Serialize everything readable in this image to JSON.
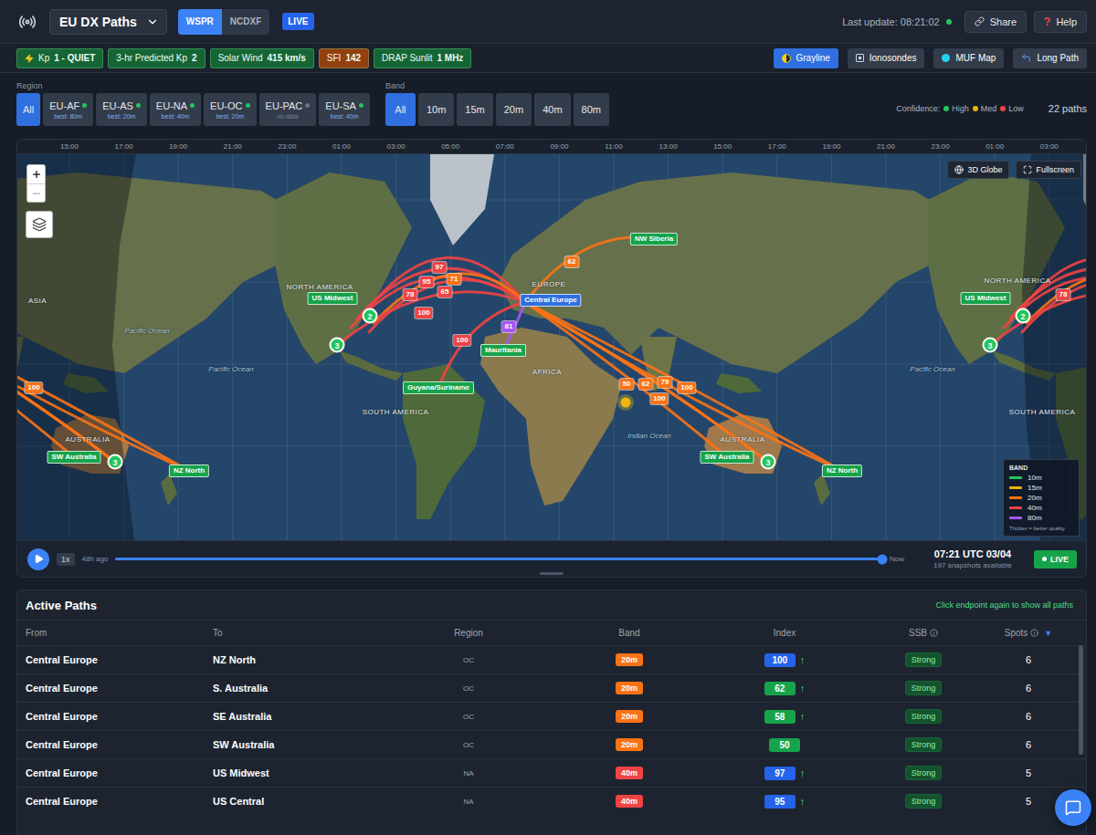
{
  "header": {
    "title": "EU DX Paths",
    "modes": [
      {
        "label": "WSPR",
        "selected": true
      },
      {
        "label": "NCDXF",
        "selected": false
      }
    ],
    "live": "LIVE",
    "last_update": "Last update: 08:21:02",
    "share": "Share",
    "help": {
      "icon": "?",
      "label": "Help"
    }
  },
  "status_chips": [
    {
      "label": "Kp",
      "value": "1 - QUIET",
      "kind": "alert",
      "color": "#166534"
    },
    {
      "label": "3-hr Predicted Kp",
      "value": "2",
      "kind": "metric",
      "color": "#166534"
    },
    {
      "label": "Solar Wind",
      "value": "415 km/s",
      "kind": "metric",
      "color": "#166534"
    },
    {
      "label": "SFI",
      "value": "142",
      "kind": "metric",
      "color": "#92400e"
    },
    {
      "label": "DRAP Sunlit",
      "value": "1 MHz",
      "kind": "metric",
      "color": "#166534"
    }
  ],
  "overlays": [
    {
      "label": "Grayline",
      "kind": "grayline",
      "selected": true
    },
    {
      "label": "Ionosondes",
      "kind": "ionosondes",
      "selected": false
    },
    {
      "label": "MUF Map",
      "kind": "muf",
      "selected": false
    },
    {
      "label": "Long Path",
      "kind": "longpath",
      "selected": false
    }
  ],
  "region": {
    "label": "Region",
    "options": [
      {
        "label": "All",
        "selected": true,
        "sub": null,
        "dot": null,
        "available": true
      },
      {
        "label": "EU-AF",
        "selected": false,
        "sub": "best: 80m",
        "dot": "#22c55e",
        "available": true
      },
      {
        "label": "EU-AS",
        "selected": false,
        "sub": "best: 20m",
        "dot": "#22c55e",
        "available": true
      },
      {
        "label": "EU-NA",
        "selected": false,
        "sub": "best: 40m",
        "dot": "#22c55e",
        "available": true
      },
      {
        "label": "EU-OC",
        "selected": false,
        "sub": "best: 20m",
        "dot": "#22c55e",
        "available": true
      },
      {
        "label": "EU-PAC",
        "selected": false,
        "sub": "no data",
        "dot": "#6b7280",
        "available": false
      },
      {
        "label": "EU-SA",
        "selected": false,
        "sub": "best: 40m",
        "dot": "#22c55e",
        "available": true
      }
    ]
  },
  "band_filter": {
    "label": "Band",
    "options": [
      {
        "label": "All",
        "selected": true
      },
      {
        "label": "10m",
        "selected": false
      },
      {
        "label": "15m",
        "selected": false
      },
      {
        "label": "20m",
        "selected": false
      },
      {
        "label": "40m",
        "selected": false
      },
      {
        "label": "80m",
        "selected": false
      }
    ]
  },
  "confidence": {
    "label": "Confidence:",
    "levels": [
      {
        "label": "High",
        "color": "#22c55e"
      },
      {
        "label": "Med",
        "color": "#eab308"
      },
      {
        "label": "Low",
        "color": "#ef4444"
      }
    ]
  },
  "path_count": "22 paths",
  "map": {
    "time_ticks": [
      "15:00",
      "17:00",
      "19:00",
      "21:00",
      "23:00",
      "01:00",
      "03:00",
      "05:00",
      "07:00",
      "09:00",
      "11:00",
      "13:00",
      "15:00",
      "17:00",
      "19:00",
      "21:00",
      "23:00",
      "01:00",
      "03:00"
    ],
    "labels": [
      {
        "text": "NORTH AMERICA",
        "kind": "continent"
      },
      {
        "text": "NORTH AMERICA",
        "kind": "continent"
      },
      {
        "text": "SOUTH AMERICA",
        "kind": "continent"
      },
      {
        "text": "SOUTH AMERICA",
        "kind": "continent"
      },
      {
        "text": "EUROPE",
        "kind": "continent"
      },
      {
        "text": "AFRICA",
        "kind": "continent"
      },
      {
        "text": "AUSTRALIA",
        "kind": "continent"
      },
      {
        "text": "AUSTRALIA",
        "kind": "continent"
      },
      {
        "text": "ASIA",
        "kind": "continent"
      },
      {
        "text": "Pacific Ocean",
        "kind": "ocean"
      },
      {
        "text": "Pacific Ocean",
        "kind": "ocean"
      },
      {
        "text": "Pacific Ocean",
        "kind": "ocean"
      },
      {
        "text": "Indian Ocean",
        "kind": "ocean"
      }
    ],
    "endpoints": [
      {
        "name": "Central Europe",
        "kind": "origin"
      },
      {
        "name": "US Midwest",
        "kind": "dest"
      },
      {
        "name": "NW Siberia",
        "kind": "dest"
      },
      {
        "name": "Mauritania",
        "kind": "dest"
      },
      {
        "name": "Guyana/Suriname",
        "kind": "dest"
      },
      {
        "name": "SW Australia",
        "kind": "dest"
      },
      {
        "name": "NZ North",
        "kind": "dest"
      }
    ],
    "clusters": [
      {
        "count": "2"
      },
      {
        "count": "3"
      },
      {
        "count": "3"
      }
    ],
    "paths": [
      {
        "band": "40m",
        "index": "97"
      },
      {
        "band": "40m",
        "index": "95"
      },
      {
        "band": "40m",
        "index": "78"
      },
      {
        "band": "40m",
        "index": "65"
      },
      {
        "band": "20m",
        "index": "71"
      },
      {
        "band": "40m",
        "index": "100"
      },
      {
        "band": "40m",
        "index": "100"
      },
      {
        "band": "80m",
        "index": "81"
      },
      {
        "band": "20m",
        "index": "62"
      },
      {
        "band": "20m",
        "index": "50"
      },
      {
        "band": "20m",
        "index": "62"
      },
      {
        "band": "20m",
        "index": "79"
      },
      {
        "band": "20m",
        "index": "100"
      },
      {
        "band": "20m",
        "index": "100"
      }
    ],
    "buttons": [
      {
        "label": "3D Globe",
        "kind": "globe"
      },
      {
        "label": "Fullscreen",
        "kind": "fullscreen"
      }
    ],
    "zoom": {
      "in_disabled": false,
      "out_disabled": true
    },
    "legend": {
      "title": "BAND",
      "items": [
        {
          "label": "10m",
          "color": "#22c55e"
        },
        {
          "label": "15m",
          "color": "#eab308"
        },
        {
          "label": "20m",
          "color": "#f97316"
        },
        {
          "label": "40m",
          "color": "#ef4444"
        },
        {
          "label": "80m",
          "color": "#a855f7"
        }
      ],
      "note": "Thicker = better quality"
    }
  },
  "timeline": {
    "playing": false,
    "speed": "1x",
    "start": "48h ago",
    "end": "Now",
    "level": 1,
    "time": "07:21 UTC 03/04",
    "snapshots": "197 snapshots available",
    "live": "LIVE"
  },
  "table": {
    "title": "Active Paths",
    "hint": "Click endpoint again to show all paths",
    "columns": [
      {
        "label": "From",
        "info": false,
        "sort": null
      },
      {
        "label": "To",
        "info": false,
        "sort": null
      },
      {
        "label": "Region",
        "info": false,
        "sort": null
      },
      {
        "label": "Band",
        "info": false,
        "sort": null
      },
      {
        "label": "Index",
        "info": false,
        "sort": null
      },
      {
        "label": "SSB",
        "info": true,
        "sort": null
      },
      {
        "label": "Spots",
        "info": true,
        "sort": "▼"
      }
    ],
    "rows": [
      {
        "from": "Central Europe",
        "to": "NZ North",
        "region": "OC",
        "band": "20m",
        "index": "100",
        "index_color": "#2563eb",
        "trend": "↑",
        "ssb": "Strong",
        "spots": "6"
      },
      {
        "from": "Central Europe",
        "to": "S. Australia",
        "region": "OC",
        "band": "20m",
        "index": "62",
        "index_color": "#16a34a",
        "trend": "↑",
        "ssb": "Strong",
        "spots": "6"
      },
      {
        "from": "Central Europe",
        "to": "SE Australia",
        "region": "OC",
        "band": "20m",
        "index": "58",
        "index_color": "#16a34a",
        "trend": "↑",
        "ssb": "Strong",
        "spots": "6"
      },
      {
        "from": "Central Europe",
        "to": "SW Australia",
        "region": "OC",
        "band": "20m",
        "index": "50",
        "index_color": "#16a34a",
        "trend": null,
        "ssb": "Strong",
        "spots": "6"
      },
      {
        "from": "Central Europe",
        "to": "US Midwest",
        "region": "NA",
        "band": "40m",
        "index": "97",
        "index_color": "#2563eb",
        "trend": "↑",
        "ssb": "Strong",
        "spots": "5"
      },
      {
        "from": "Central Europe",
        "to": "US Central",
        "region": "NA",
        "band": "40m",
        "index": "95",
        "index_color": "#2563eb",
        "trend": "↑",
        "ssb": "Strong",
        "spots": "5"
      }
    ]
  }
}
